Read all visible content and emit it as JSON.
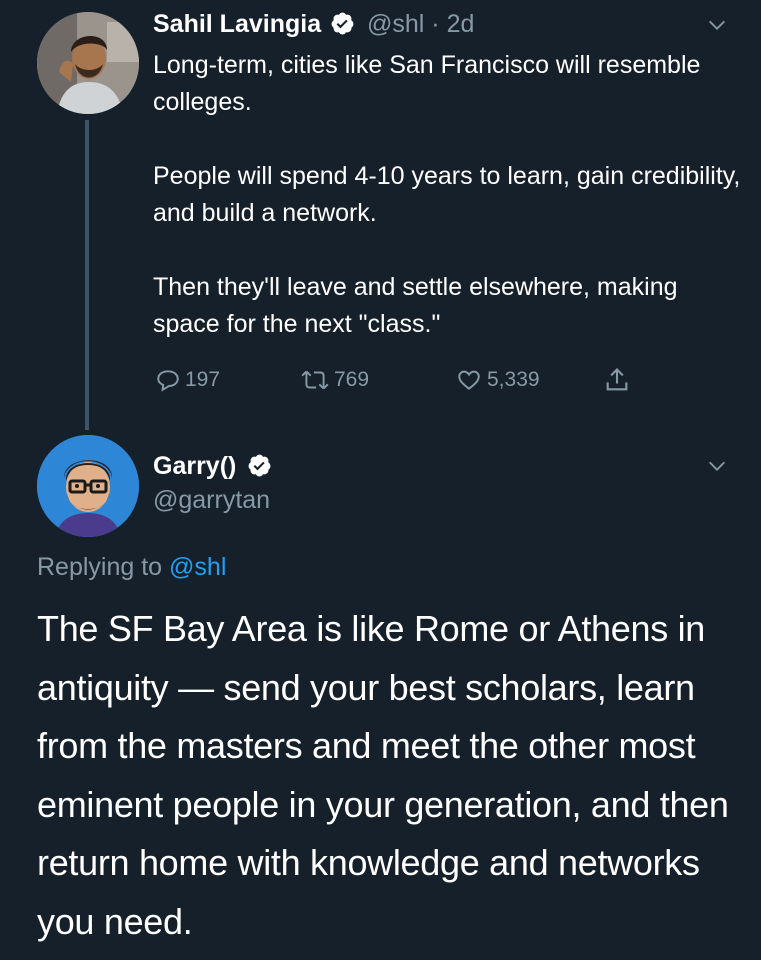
{
  "tweet1": {
    "author_name": "Sahil Lavingia",
    "handle_time": "@shl · 2d",
    "paragraphs": [
      "Long-term, cities like San Francisco will resemble colleges.",
      "People will spend 4-10 years to learn, gain credibility, and build a network.",
      "Then they'll leave and settle elsewhere, making space for the next \"class.\""
    ],
    "replies": "197",
    "retweets": "769",
    "likes": "5,339"
  },
  "tweet2": {
    "author_name": "Garry()",
    "handle": "@garrytan",
    "replying_prefix": "Replying to ",
    "replying_mention": "@shl",
    "text": "The SF Bay Area is like Rome or Athens in antiquity — send your best scholars, learn from the masters and meet the other most eminent people in your generation, and then return home with knowledge and networks you need."
  },
  "colors": {
    "background": "#15202b",
    "secondary_text": "#8899a6",
    "link": "#1da1f2",
    "thread_line": "#3d5466"
  }
}
